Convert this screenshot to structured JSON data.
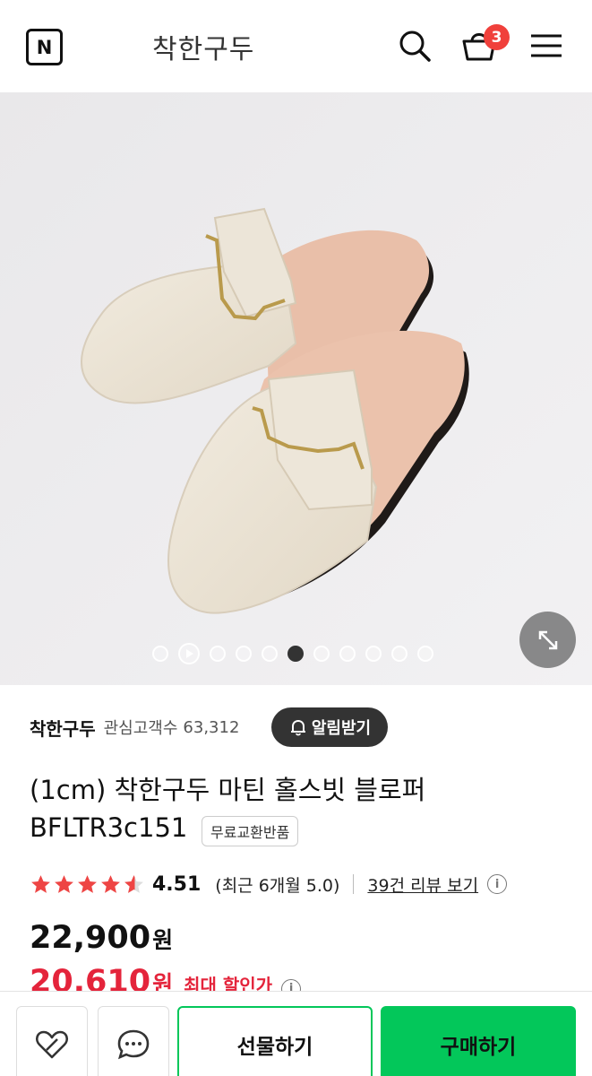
{
  "header": {
    "logo_letter": "N",
    "store_title": "착한구두",
    "cart_count": "3"
  },
  "gallery": {
    "dot_count": 11,
    "active_index": 5
  },
  "brand": {
    "name": "착한구두",
    "follower_label": "관심고객수",
    "follower_count": "63,312",
    "alert_button": "알림받기"
  },
  "product": {
    "title_line1": "(1cm) 착한구두 마틴 홀스빗 블로퍼",
    "title_line2": "BFLTR3c151",
    "badge": "무료교환반품"
  },
  "rating": {
    "value": "4.51",
    "stars_fraction": 0.902,
    "recent": "(최근 6개월 5.0)",
    "review_link": "39건 리뷰 보기"
  },
  "price": {
    "original": "22,900",
    "original_unit": "원",
    "discount": "20,610",
    "discount_unit": "원",
    "discount_label": "최대 할인가"
  },
  "bottom_bar": {
    "gift_label": "선물하기",
    "buy_label": "구매하기"
  },
  "colors": {
    "accent_green": "#03c75a",
    "badge_red": "#f0403b",
    "discount_red": "#e4243b"
  }
}
